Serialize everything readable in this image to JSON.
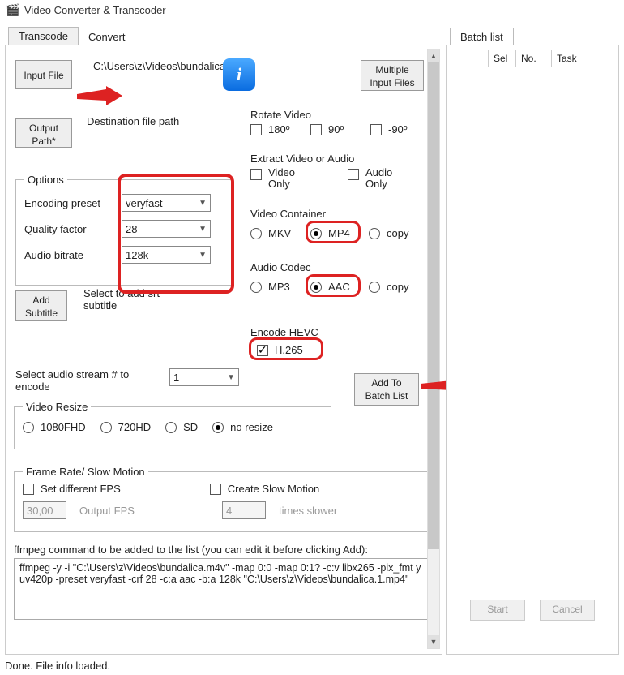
{
  "window": {
    "title": "Video Converter & Transcoder"
  },
  "tabs_left": {
    "items": [
      "Transcode",
      "Convert"
    ],
    "active": 1
  },
  "tabs_right": {
    "items": [
      "Batch list"
    ],
    "active": 0
  },
  "input_file": {
    "button": "Input File",
    "path": "C:\\Users\\z\\Videos\\bundalica.m4v",
    "multi_button": "Multiple\nInput Files"
  },
  "output": {
    "button": "Output\nPath*",
    "label": "Destination file path"
  },
  "options": {
    "legend": "Options",
    "rows": [
      {
        "label": "Encoding preset",
        "value": "veryfast"
      },
      {
        "label": "Quality factor",
        "value": "28"
      },
      {
        "label": "Audio bitrate",
        "value": "128k"
      }
    ]
  },
  "subtitle": {
    "button": "Add\nSubtitle",
    "hint": "Select to add srt subtitle"
  },
  "rotate": {
    "legend": "Rotate Video",
    "items": [
      {
        "label": "180º",
        "checked": false
      },
      {
        "label": "90º",
        "checked": false
      },
      {
        "label": "-90º",
        "checked": false
      }
    ]
  },
  "extract": {
    "legend": "Extract Video or Audio",
    "items": [
      {
        "label": "Video\nOnly",
        "checked": false
      },
      {
        "label": "Audio\nOnly",
        "checked": false
      }
    ]
  },
  "container": {
    "legend": "Video Container",
    "items": [
      {
        "label": "MKV",
        "checked": false
      },
      {
        "label": "MP4",
        "checked": true
      },
      {
        "label": "copy",
        "checked": false
      }
    ]
  },
  "acodec": {
    "legend": "Audio Codec",
    "items": [
      {
        "label": "MP3",
        "checked": false
      },
      {
        "label": "AAC",
        "checked": true
      },
      {
        "label": "copy",
        "checked": false
      }
    ]
  },
  "hevc": {
    "legend": "Encode HEVC",
    "label": "H.265",
    "checked": true
  },
  "audio_stream": {
    "label": "Select audio stream # to encode",
    "value": "1"
  },
  "add_batch": "Add To\nBatch List",
  "resize": {
    "legend": "Video Resize",
    "items": [
      {
        "label": "1080FHD",
        "checked": false
      },
      {
        "label": "720HD",
        "checked": false
      },
      {
        "label": "SD",
        "checked": false
      },
      {
        "label": "no resize",
        "checked": true
      }
    ]
  },
  "framerate": {
    "legend": "Frame Rate/ Slow Motion",
    "set_fps_label": "Set different FPS",
    "set_fps_checked": false,
    "fps_value": "30,00",
    "fps_hint": "Output FPS",
    "slow_label": "Create Slow Motion",
    "slow_checked": false,
    "slow_value": "4",
    "slow_hint": "times slower"
  },
  "cmd": {
    "label": "ffmpeg command to be added to the list (you can edit it before clicking Add):",
    "text": "ffmpeg -y -i \"C:\\Users\\z\\Videos\\bundalica.m4v\" -map 0:0 -map 0:1? -c:v libx265 -pix_fmt yuv420p -preset veryfast -crf 28  -c:a aac -b:a 128k \"C:\\Users\\z\\Videos\\bundalica.1.mp4\""
  },
  "batch": {
    "columns": [
      "Sel",
      "No.",
      "Task"
    ],
    "start": "Start",
    "cancel": "Cancel"
  },
  "status": "Done. File info loaded."
}
